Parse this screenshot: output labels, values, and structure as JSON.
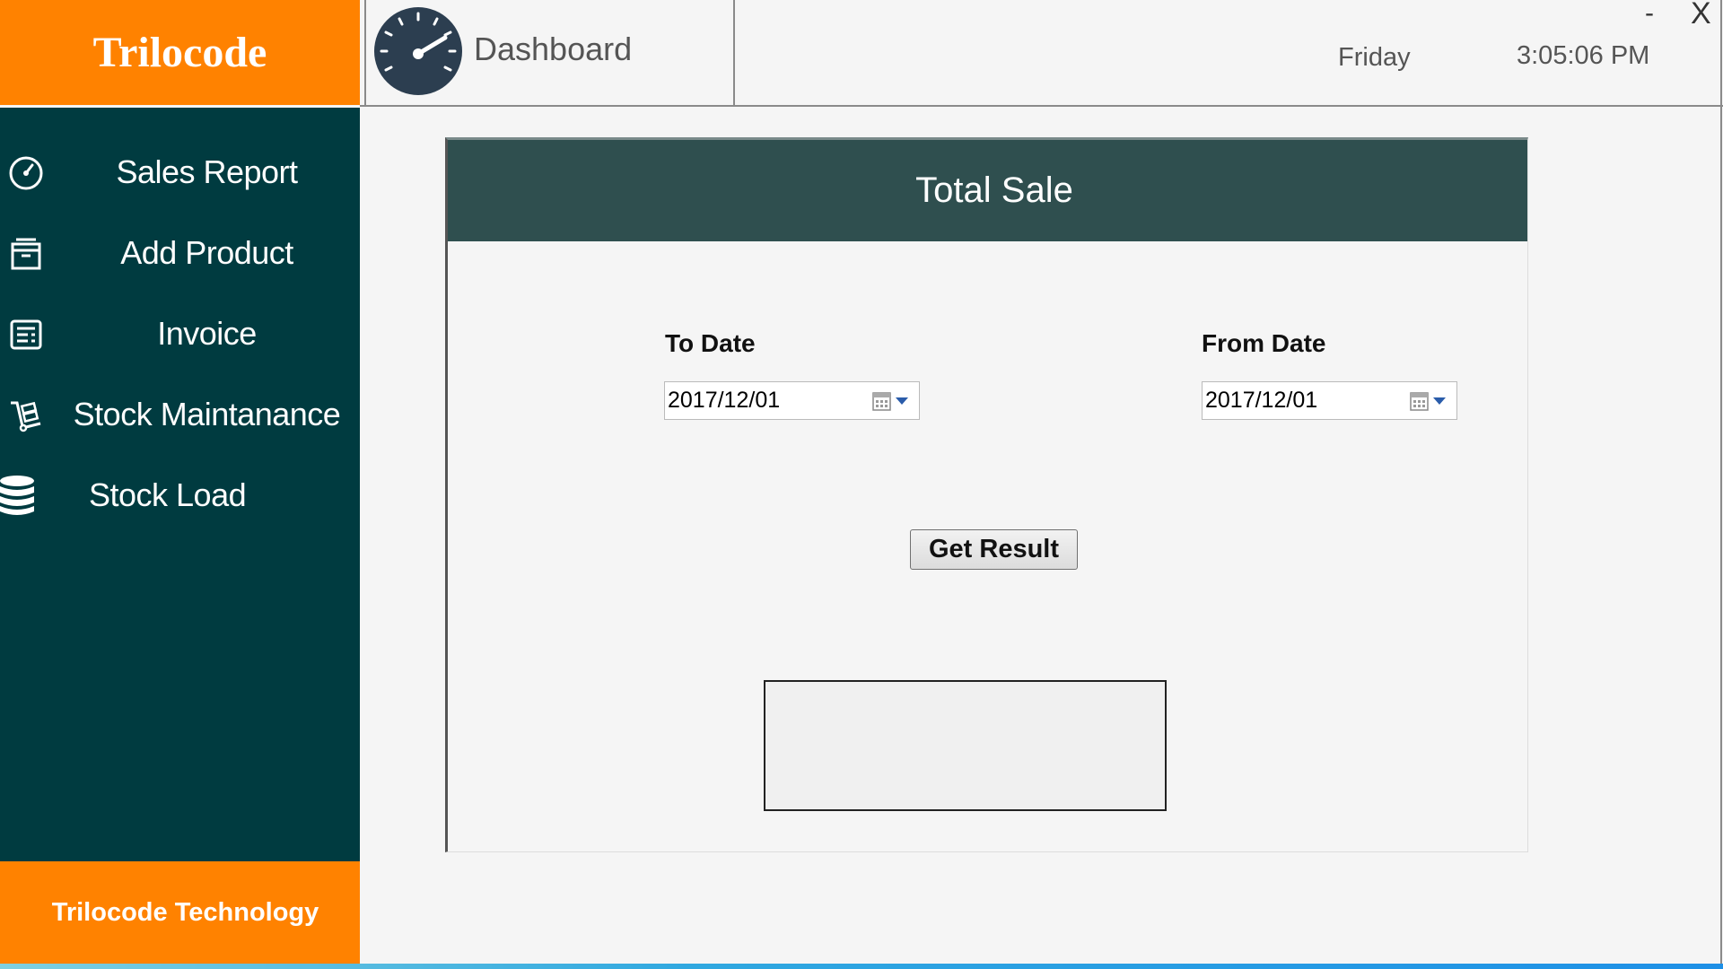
{
  "sidebar": {
    "brand": "Trilocode",
    "items": [
      {
        "label": "Sales Report",
        "icon": "speedometer-icon"
      },
      {
        "label": "Add Product",
        "icon": "box-icon"
      },
      {
        "label": "Invoice",
        "icon": "invoice-icon"
      },
      {
        "label": "Stock Maintanance",
        "icon": "hand-truck-icon"
      },
      {
        "label": "Stock Load",
        "icon": "database-icon"
      }
    ],
    "footer": "Trilocode Technology"
  },
  "header": {
    "tab_title": "Dashboard",
    "tab_icon": "gauge-icon",
    "day": "Friday",
    "time": "3:05:06 PM",
    "minimize_label": "-",
    "close_label": "X"
  },
  "panel": {
    "title": "Total Sale",
    "to_date": {
      "label": "To Date",
      "value": "2017/12/01"
    },
    "from_date": {
      "label": "From Date",
      "value": "2017/12/01"
    },
    "button_label": "Get Result",
    "result_value": ""
  },
  "colors": {
    "brand_orange": "#ff8200",
    "sidebar_teal": "#003b40",
    "panel_header": "#2f4f4f",
    "gauge_navy": "#2c3e50"
  }
}
